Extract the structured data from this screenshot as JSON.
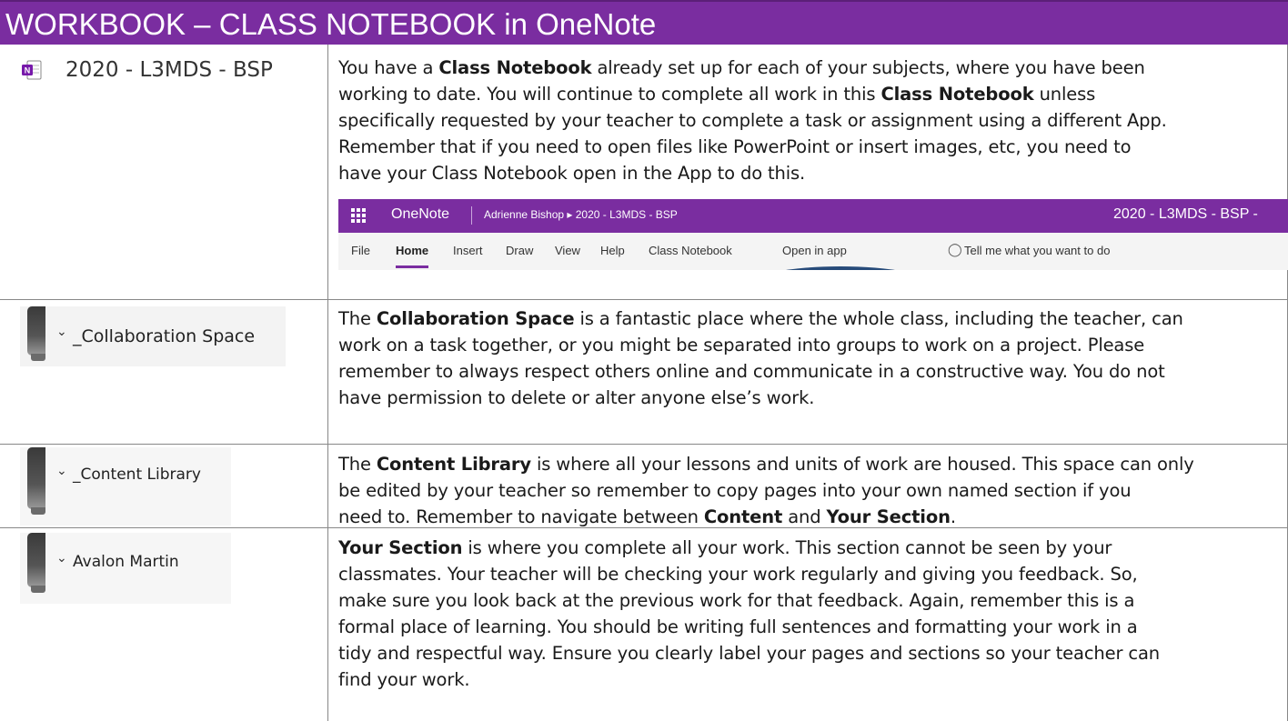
{
  "header": {
    "title": "WORKBOOK – CLASS NOTEBOOK in OneNote"
  },
  "colors": {
    "header_bg": "#7a2da0",
    "oval": "#274b7a"
  },
  "rows": [
    {
      "left_label": "2020 - L3MDS - BSP",
      "left_icon": "onenote-icon",
      "lines": [
        [
          "You have a ",
          {
            "b": "Class Notebook"
          },
          " already set up for each of your subjects, where you have been"
        ],
        [
          "working to date. You will continue to complete all work in this ",
          {
            "b": "Class Notebook"
          },
          " unless"
        ],
        [
          "specifically requested by your teacher to complete a task or assignment using a different App."
        ],
        [
          "Remember that if you need to open files like PowerPoint or insert images, etc, you need to"
        ],
        [
          "have your Class Notebook open in the App to do this."
        ]
      ]
    },
    {
      "left_label": "_Collaboration Space",
      "lines": [
        [
          "The ",
          {
            "b": "Collaboration Space"
          },
          " is a fantastic place where the whole class, including the teacher, can"
        ],
        [
          "work on a task together, or you might be separated into groups to work on a project. Please"
        ],
        [
          "remember to always respect others online and communicate in a constructive way. You do not"
        ],
        [
          "have permission to delete or alter anyone else’s work."
        ]
      ]
    },
    {
      "left_label": "_Content Library",
      "lines": [
        [
          "The ",
          {
            "b": "Content Library"
          },
          " is where all your lessons and units of work are housed. This space can only"
        ],
        [
          "be edited by your teacher so remember to copy pages into your own named section if you"
        ],
        [
          "need to. Remember to navigate between ",
          {
            "b": "Content"
          },
          " and ",
          {
            "b": "Your Section"
          },
          "."
        ]
      ]
    },
    {
      "left_label": "Avalon Martin",
      "lines": [
        [
          {
            "b": "Your Section"
          },
          " is where you complete all your work.  This section cannot be seen by your"
        ],
        [
          "classmates. Your teacher will be checking your work regularly and giving you feedback. So,"
        ],
        [
          "make sure you look back at the previous work for that feedback. Again, remember this is a"
        ],
        [
          "formal place of learning. You should be writing full sentences and formatting your work in a"
        ],
        [
          "tidy and respectful way. Ensure you clearly label your pages and sections so your teacher can"
        ],
        [
          "find your work."
        ]
      ]
    }
  ],
  "onenote": {
    "app_name": "OneNote",
    "breadcrumb": "Adrienne Bishop ▸ 2020 - L3MDS - BSP",
    "notebook_right": "2020 - L3MDS - BSP  -",
    "tabs": [
      "File",
      "Home",
      "Insert",
      "Draw",
      "View",
      "Help",
      "Class Notebook",
      "Open in app"
    ],
    "active_tab": "Home",
    "tell_me": "Tell me what you want to do"
  }
}
